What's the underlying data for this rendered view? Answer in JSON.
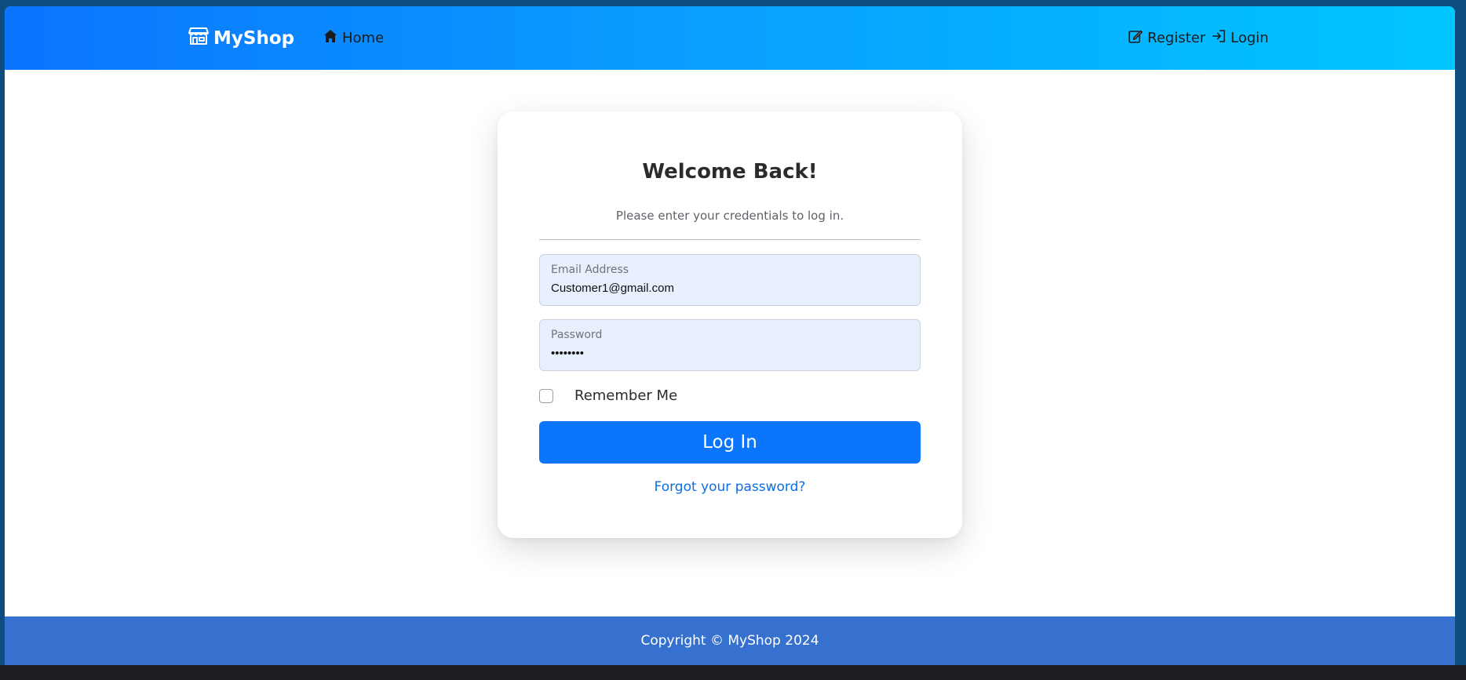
{
  "navbar": {
    "brand": "MyShop",
    "home": "Home",
    "register": "Register",
    "login": "Login"
  },
  "login_card": {
    "title": "Welcome Back!",
    "subtitle": "Please enter your credentials to log in.",
    "email": {
      "label": "Email Address",
      "value": "Customer1@gmail.com"
    },
    "password": {
      "label": "Password",
      "value": "••••••••"
    },
    "remember_me": "Remember Me",
    "remember_checked": false,
    "submit": "Log In",
    "forgot": "Forgot your password?"
  },
  "footer": {
    "copyright": "Copyright © MyShop 2024"
  },
  "icons": {
    "brand": "store-icon",
    "home": "house-icon",
    "register": "edit-icon",
    "login": "login-icon"
  },
  "colors": {
    "nav_gradient_start": "#0a74ff",
    "nav_gradient_end": "#00c6ff",
    "primary_button": "#0b76fb",
    "link": "#0b6ee8",
    "footer": "#3671cf",
    "input_bg": "#e8f0fe"
  }
}
